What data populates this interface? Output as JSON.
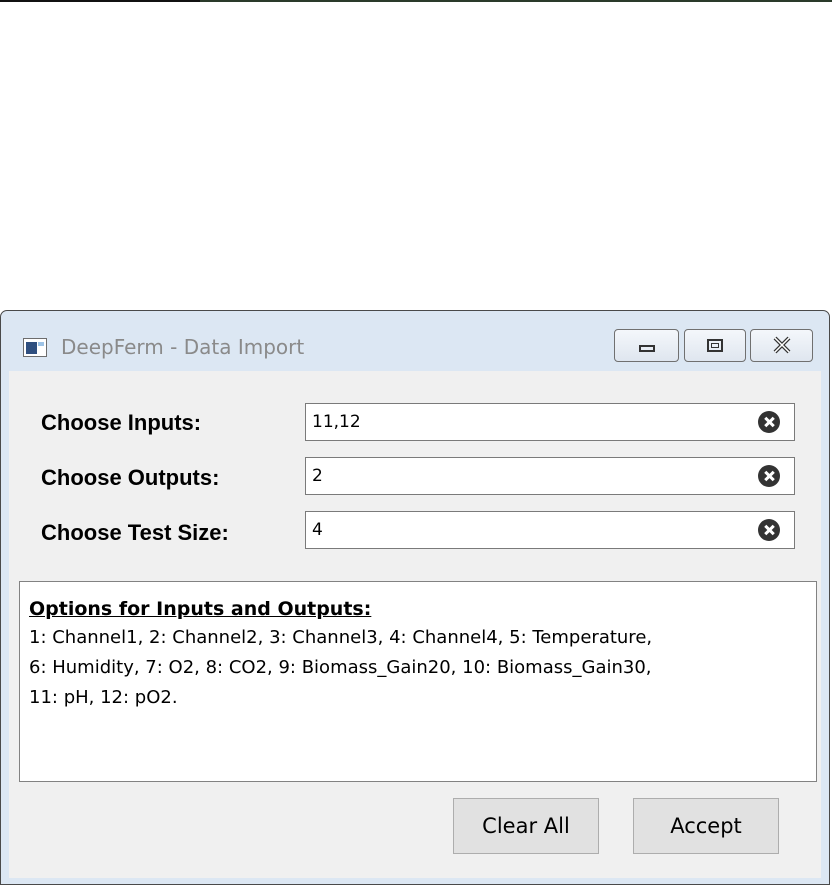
{
  "window": {
    "title": "DeepFerm - Data Import",
    "icons": {
      "app": "app-window-icon",
      "minimize": "minimize-icon",
      "maximize": "maximize-icon",
      "close": "close-icon",
      "clear_field": "clear-circle-x-icon"
    }
  },
  "form": {
    "inputs": {
      "label": "Choose Inputs:",
      "value": "11,12"
    },
    "outputs": {
      "label": "Choose Outputs:",
      "value": "2"
    },
    "test_size": {
      "label": "Choose Test Size:",
      "value": "4"
    }
  },
  "options": {
    "heading": "Options for Inputs and Outputs:",
    "lines": [
      "1: Channel1, 2: Channel2, 3: Channel3, 4: Channel4, 5: Temperature,",
      "6: Humidity, 7: O2, 8: CO2, 9: Biomass_Gain20, 10: Biomass_Gain30,",
      "11: pH, 12: pO2."
    ]
  },
  "buttons": {
    "clear_all": "Clear All",
    "accept": "Accept"
  }
}
